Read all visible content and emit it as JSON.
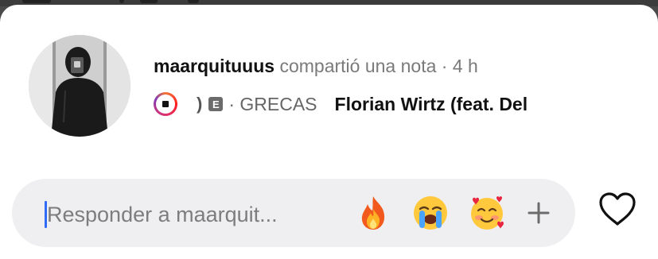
{
  "note": {
    "username": "maarquituuus",
    "action_text": "compartió una nota",
    "time": "· 4 h"
  },
  "music": {
    "partial_title": ")",
    "explicit_badge": "E",
    "artist": "· GRECAS",
    "song": "Florian Wirtz (feat. Del"
  },
  "reply": {
    "placeholder": "Responder a maarquit...",
    "reactions": [
      "fire-emoji",
      "loudly-crying-emoji",
      "smiling-face-with-hearts-emoji"
    ],
    "more_icon": "plus-icon"
  },
  "like_icon": "heart-icon",
  "colors": {
    "background_dim": "#4a4a4a",
    "sheet": "#ffffff",
    "input_bg": "#efeff1",
    "cursor": "#2e6cf6",
    "secondary_text": "#7a7a7a"
  }
}
